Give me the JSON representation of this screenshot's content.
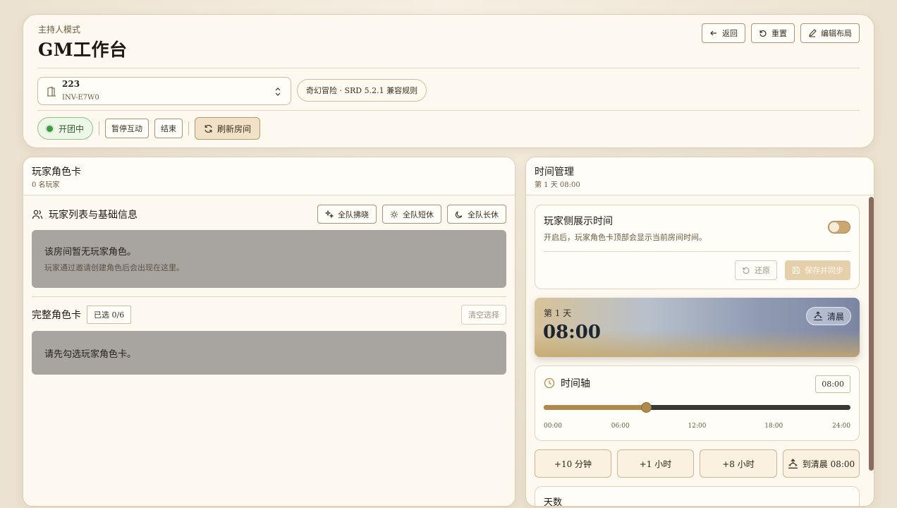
{
  "header": {
    "mode_label": "主持人模式",
    "title": "GM工作台",
    "actions": {
      "back": "返回",
      "reset": "重置",
      "edit_layout": "编辑布局"
    },
    "room": {
      "name": "223",
      "code": "INV-E7W0"
    },
    "rules_label": "奇幻冒险 · SRD 5.2.1 兼容规则",
    "status": "开团中",
    "pause": "暂停互动",
    "end": "结束",
    "refresh": "刷新房间",
    "status_color": "#3f9a44"
  },
  "players": {
    "title": "玩家角色卡",
    "subtitle": "0 名玩家",
    "list_title": "玩家列表与基础信息",
    "party_actions": {
      "dawn": "全队拂晓",
      "short_rest": "全队短休",
      "long_rest": "全队长休"
    },
    "empty_main": "该房间暂无玩家角色。",
    "empty_hint": "玩家通过邀请创建角色后会出现在这里。",
    "full_title": "完整角色卡",
    "selected": "已选 0/6",
    "clear": "清空选择",
    "full_empty": "请先勾选玩家角色卡。"
  },
  "time": {
    "title": "时间管理",
    "subtitle": "第 1 天 08:00",
    "display": {
      "title": "玩家侧展示时间",
      "desc": "开启后，玩家角色卡顶部会显示当前房间时间。",
      "restore": "还原",
      "save": "保存并同步"
    },
    "sky": {
      "day": "第 1 天",
      "time": "08:00",
      "period": "清晨"
    },
    "timeline": {
      "title": "时间轴",
      "value": "08:00",
      "progress": 0.3333,
      "ticks": [
        "00:00",
        "06:00",
        "12:00",
        "18:00",
        "24:00"
      ]
    },
    "quick": {
      "plus10": "+10 分钟",
      "plus1h": "+1 小时",
      "plus8h": "+8 小时",
      "to_dawn": "到清晨 08:00"
    },
    "days_label": "天数",
    "accent": "#b08a4c"
  }
}
